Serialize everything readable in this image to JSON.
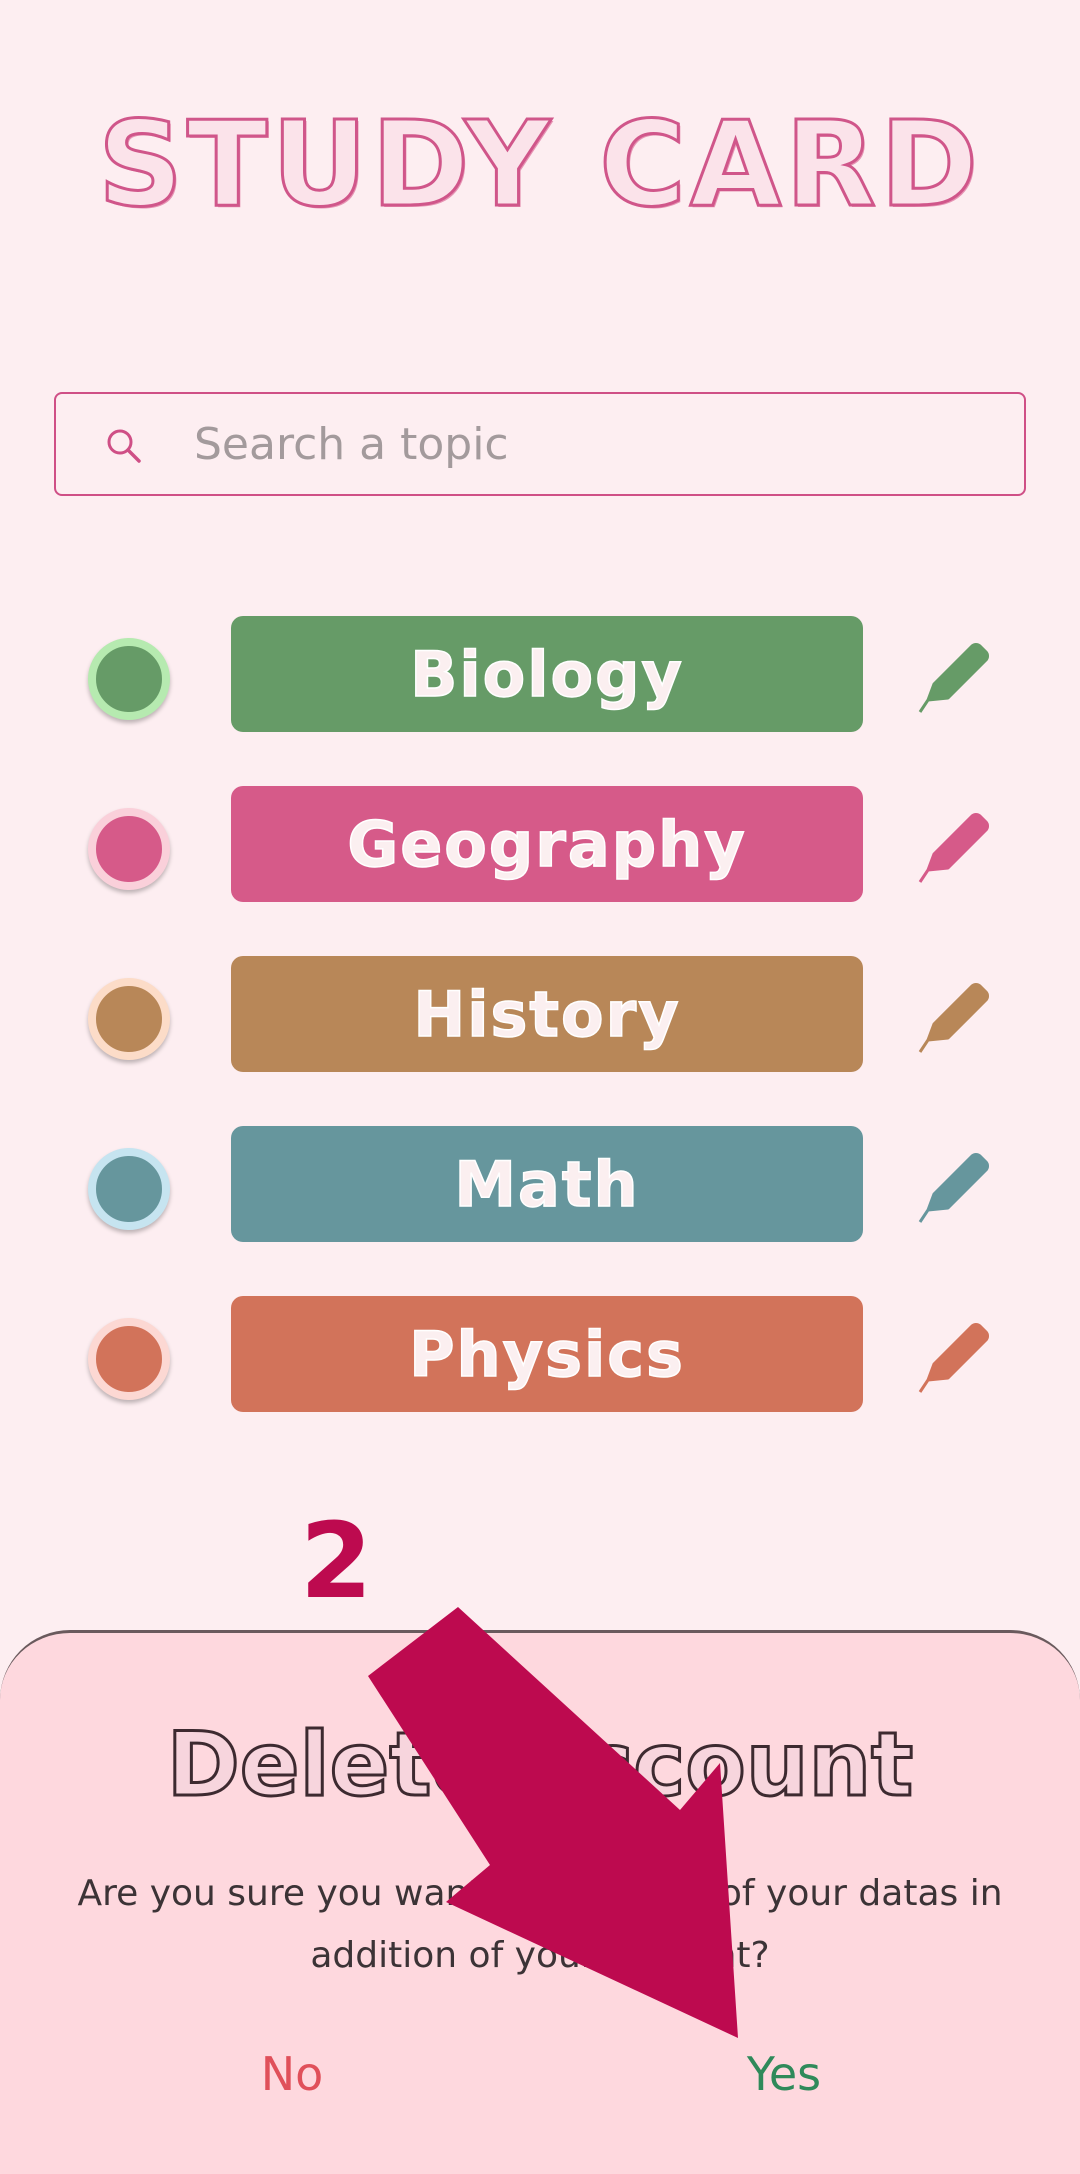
{
  "app": {
    "title": "STUDY CARD"
  },
  "search": {
    "placeholder": "Search a topic",
    "value": ""
  },
  "topics": [
    {
      "label": "Biology",
      "color": "#669b67",
      "ring": "#b6eab0"
    },
    {
      "label": "Geography",
      "color": "#d65a89",
      "ring": "#fad0da"
    },
    {
      "label": "History",
      "color": "#b88758",
      "ring": "#fcdcc8"
    },
    {
      "label": "Math",
      "color": "#66969d",
      "ring": "#c6e4f0"
    },
    {
      "label": "Physics",
      "color": "#d2735a",
      "ring": "#fcd8d3"
    }
  ],
  "annotation": {
    "step": "2",
    "arrow_color": "#bd0a4f"
  },
  "dialog": {
    "title": "Delete account",
    "message": "Are you sure you want to delete all of your datas in addition of your account?",
    "no_label": "No",
    "yes_label": "Yes"
  },
  "icons": {
    "search": "search-icon",
    "edit": "pencil-icon"
  }
}
